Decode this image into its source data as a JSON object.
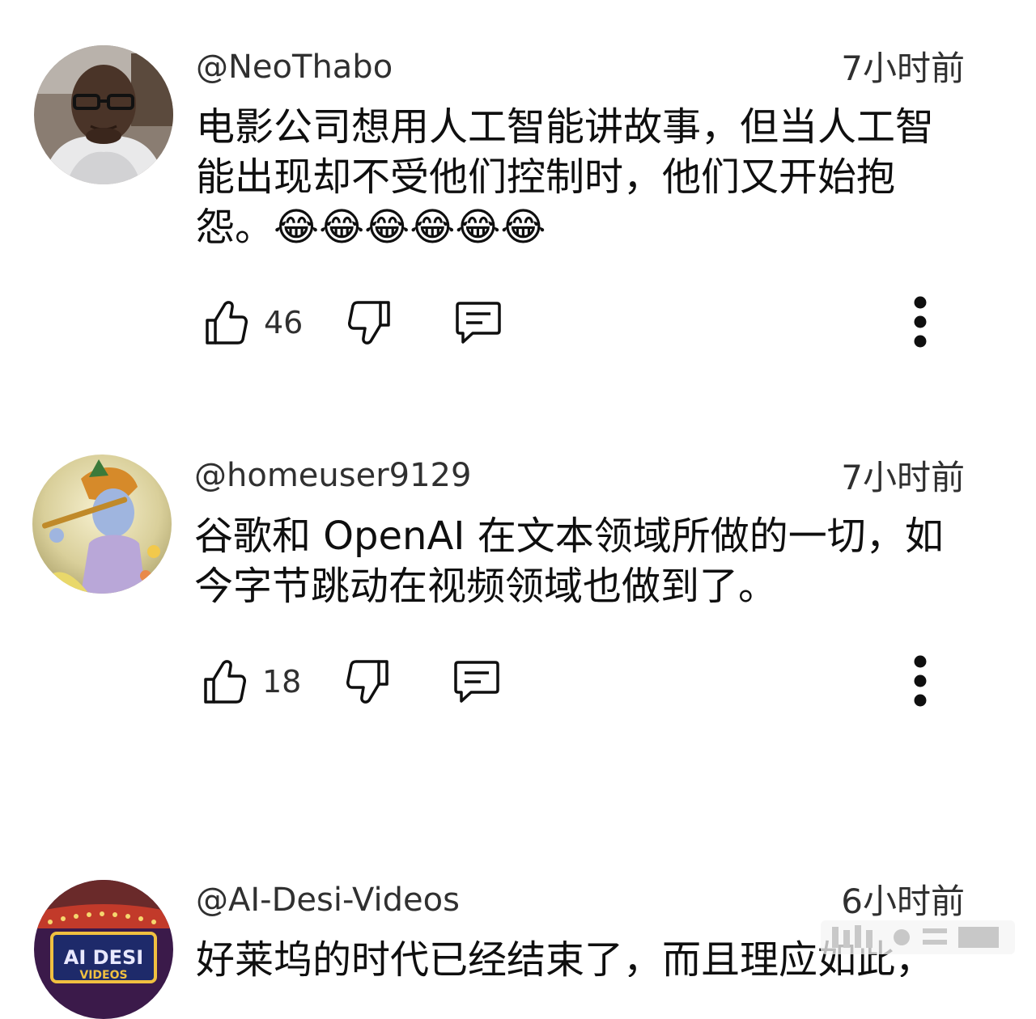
{
  "comments": [
    {
      "handle": "@NeoThabo",
      "time": "7小时前",
      "text": "电影公司想用人工智能讲故事，但当人工智能出现却不受他们控制时，他们又开始抱怨。😂😂😂😂😂😂",
      "likes": "46",
      "avatar_icon": "avatar-person-glasses"
    },
    {
      "handle": "@homeuser9129",
      "time": "7小时前",
      "text": "谷歌和 OpenAI 在文本领域所做的一切，如今字节跳动在视频领域也做到了。",
      "likes": "18",
      "avatar_icon": "avatar-krishna-painting"
    },
    {
      "handle": "@AI-Desi-Videos",
      "time": "6小时前",
      "text": "好莱坞的时代已经结束了，而且理应如此，",
      "avatar_icon": "avatar-ai-desi-videos-logo",
      "avatar_logo_text": "AI DESI VIDEOS"
    }
  ],
  "icons": {
    "like": "thumbs-up-icon",
    "dislike": "thumbs-down-icon",
    "reply": "comment-reply-icon",
    "more": "more-vertical-icon"
  },
  "colors": {
    "text": "#0f0f0f",
    "secondary": "#303030",
    "background": "#ffffff"
  }
}
